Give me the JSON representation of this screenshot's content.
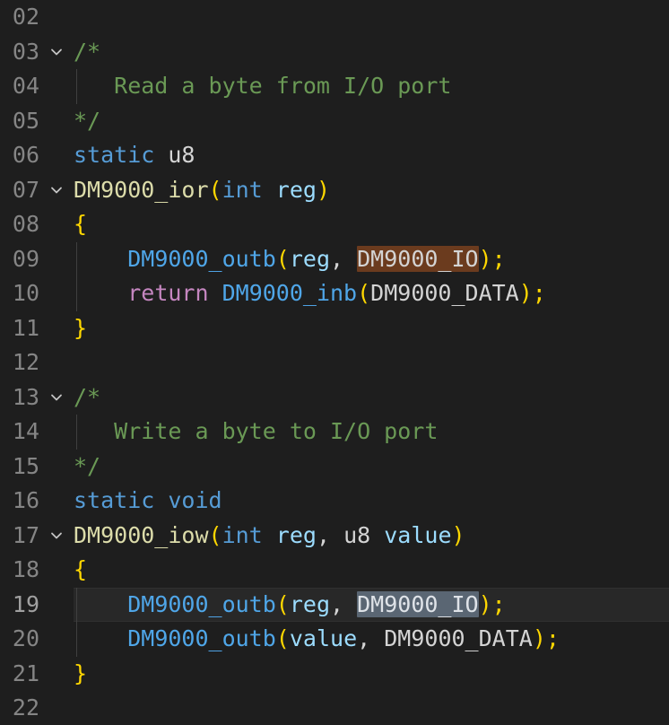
{
  "editor": {
    "theme": "vscode-dark-plus",
    "language": "c",
    "background": "#1e1e1e",
    "active_line": 19,
    "gutter": {
      "line_numbers": [
        "02",
        "03",
        "04",
        "05",
        "06",
        "07",
        "08",
        "09",
        "10",
        "11",
        "12",
        "13",
        "14",
        "15",
        "16",
        "17",
        "18",
        "19",
        "20",
        "21",
        "22"
      ],
      "fold_marker_lines": [
        "03",
        "07",
        "13",
        "17"
      ],
      "fold_icon": "chevron-down-icon"
    },
    "colors": {
      "comment": "#6a9955",
      "keyword": "#569cd6",
      "control_keyword": "#c586c0",
      "function_declaration": "#dcdcaa",
      "function_call": "#4fa6e8",
      "parameter": "#9cdcfe",
      "identifier": "#d4d4d4",
      "bracket_level_1": "#ffd700",
      "bracket_level_2": "#da70d6",
      "line_number": "#858585",
      "active_line_background": "#282828",
      "find_match_highlight": "#6b3b1e",
      "selection_highlight": "#5a6673",
      "indent_guide": "#404040"
    }
  },
  "lines": [
    {
      "n": "02",
      "text": ""
    },
    {
      "n": "03",
      "text": "/*"
    },
    {
      "n": "04",
      "text": "   Read a byte from I/O port"
    },
    {
      "n": "05",
      "text": "*/"
    },
    {
      "n": "06",
      "text": "static u8"
    },
    {
      "n": "07",
      "text": "DM9000_ior(int reg)"
    },
    {
      "n": "08",
      "text": "{"
    },
    {
      "n": "09",
      "text": "    DM9000_outb(reg, DM9000_IO);"
    },
    {
      "n": "10",
      "text": "    return DM9000_inb(DM9000_DATA);"
    },
    {
      "n": "11",
      "text": "}"
    },
    {
      "n": "12",
      "text": ""
    },
    {
      "n": "13",
      "text": "/*"
    },
    {
      "n": "14",
      "text": "   Write a byte to I/O port"
    },
    {
      "n": "15",
      "text": "*/"
    },
    {
      "n": "16",
      "text": "static void"
    },
    {
      "n": "17",
      "text": "DM9000_iow(int reg, u8 value)"
    },
    {
      "n": "18",
      "text": "{"
    },
    {
      "n": "19",
      "text": "    DM9000_outb(reg, DM9000_IO);"
    },
    {
      "n": "20",
      "text": "    DM9000_outb(value, DM9000_DATA);"
    },
    {
      "n": "21",
      "text": "}"
    },
    {
      "n": "22",
      "text": ""
    }
  ],
  "tokens": {
    "l03_comment": "/*",
    "l04_comment": "   Read a byte from I/O port",
    "l05_comment": "*/",
    "l06_static": "static",
    "l06_type": "u8",
    "l07_fn": "DM9000_ior",
    "l07_open": "(",
    "l07_int": "int",
    "l07_reg": "reg",
    "l07_close": ")",
    "l08_brace": "{",
    "l09_call": "DM9000_outb",
    "l09_open": "(",
    "l09_reg": "reg",
    "l09_comma": ", ",
    "l09_match": "DM9000_IO",
    "l09_close": ");",
    "l10_return": "return",
    "l10_call": "DM9000_inb",
    "l10_open": "(",
    "l10_arg": "DM9000_DATA",
    "l10_close": ");",
    "l11_brace": "}",
    "l13_comment": "/*",
    "l14_comment": "   Write a byte to I/O port",
    "l15_comment": "*/",
    "l16_static": "static",
    "l16_void": "void",
    "l17_fn": "DM9000_iow",
    "l17_open": "(",
    "l17_int": "int",
    "l17_reg": "reg",
    "l17_comma": ", ",
    "l17_u8": "u8",
    "l17_value": "value",
    "l17_close": ")",
    "l18_brace": "{",
    "l19_call": "DM9000_outb",
    "l19_open": "(",
    "l19_reg": "reg",
    "l19_comma": ", ",
    "l19_selection": "DM9000_IO",
    "l19_close": ");",
    "l20_call": "DM9000_outb",
    "l20_open": "(",
    "l20_value": "value",
    "l20_comma": ", ",
    "l20_arg": "DM9000_DATA",
    "l20_close": ");",
    "l21_brace": "}"
  }
}
